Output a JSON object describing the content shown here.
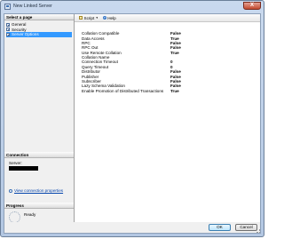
{
  "window": {
    "title": "New Linked Server",
    "close_glyph": "X"
  },
  "left_pane": {
    "select_page_header": "Select a page",
    "pages": [
      {
        "label": "General",
        "icon": "page-icon"
      },
      {
        "label": "Security",
        "icon": "page-icon"
      },
      {
        "label": "Server Options",
        "icon": "page-icon",
        "selected": true
      }
    ],
    "connection_header": "Connection",
    "server_label": "Server:",
    "view_connection_properties": "View connection properties",
    "progress_header": "Progress",
    "progress_status": "Ready"
  },
  "toolbar": {
    "script_label": "Script",
    "help_label": "Help"
  },
  "properties": [
    {
      "name": "Collation Compatible",
      "value": "False"
    },
    {
      "name": "Data Access",
      "value": "True"
    },
    {
      "name": "RPC",
      "value": "False"
    },
    {
      "name": "RPC Out",
      "value": "False"
    },
    {
      "name": "Use Remote Collation",
      "value": "True"
    },
    {
      "name": "Collation Name",
      "value": ""
    },
    {
      "name": "Connection Timeout",
      "value": "0"
    },
    {
      "name": "Query Timeout",
      "value": "0"
    },
    {
      "name": "Distributor",
      "value": "False"
    },
    {
      "name": "Publisher",
      "value": "False"
    },
    {
      "name": "Subscriber",
      "value": "False"
    },
    {
      "name": "Lazy Schema Validation",
      "value": "False"
    },
    {
      "name": "Enable Promotion of Distributed Transactions",
      "value": "True"
    }
  ],
  "footer": {
    "ok_label": "OK",
    "cancel_label": "Cancel"
  },
  "colors": {
    "selection": "#3399ff",
    "link": "#0645ad",
    "title_bar": "#c9d9ee"
  }
}
